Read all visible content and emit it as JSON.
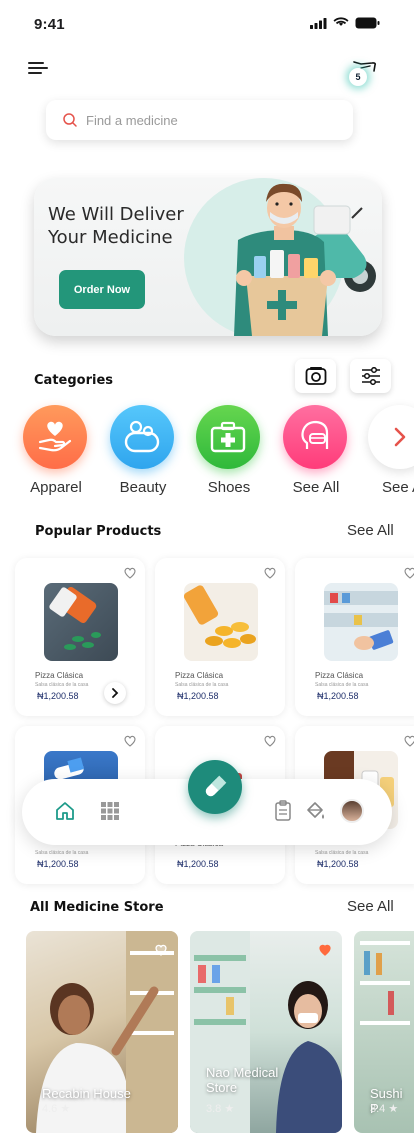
{
  "status_bar": {
    "time": "9:41"
  },
  "header": {
    "cart_count": "5"
  },
  "search": {
    "placeholder": "Find a medicine"
  },
  "banner": {
    "title": "We Will Deliver Your Medicine",
    "button_label": "Order Now"
  },
  "categories": {
    "title": "Categories",
    "items": [
      {
        "label": "Apparel",
        "icon": "hand-heart-icon",
        "color": "#ff7b4f"
      },
      {
        "label": "Beauty",
        "icon": "bubbles-icon",
        "color": "#3ab6f5"
      },
      {
        "label": "Shoes",
        "icon": "medkit-icon",
        "color": "#3ec84a"
      },
      {
        "label": "See All",
        "icon": "face-mask-icon",
        "color": "#ff4f8b"
      },
      {
        "label": "See All",
        "icon": "chevron-right-icon",
        "color": "#ffffff"
      }
    ]
  },
  "popular": {
    "title": "Popular Products",
    "see_all": "See All",
    "products": [
      {
        "name": "Pizza Clásica",
        "desc": "Salsa clásica de la casa",
        "price": "₦1,200.58"
      },
      {
        "name": "Pizza Clásica",
        "desc": "Salsa clásica de la casa",
        "price": "₦1,200.58"
      },
      {
        "name": "Pizza Clásica",
        "desc": "Salsa clásica de la casa",
        "price": "₦1,200.58"
      },
      {
        "name": "",
        "desc": "Salsa clásica de la casa",
        "price": "₦1,200.58"
      },
      {
        "name": "Pizza Clásica",
        "desc": "",
        "price": "₦1,200.58"
      },
      {
        "name": "",
        "desc": "Salsa clásica de la casa",
        "price": "₦1,200.58"
      }
    ]
  },
  "stores": {
    "title": "All Medicine Store",
    "see_all": "See All",
    "items": [
      {
        "name": "Recabin House",
        "rating": "4.6 ★"
      },
      {
        "name": "Nao Medical Store",
        "rating": "3.8 ★"
      },
      {
        "name": "Sushi P",
        "rating": "3.4 ★"
      }
    ]
  },
  "colors": {
    "brand": "#1e8b7b",
    "order_button": "#23967a",
    "price": "#1f2f6b"
  }
}
